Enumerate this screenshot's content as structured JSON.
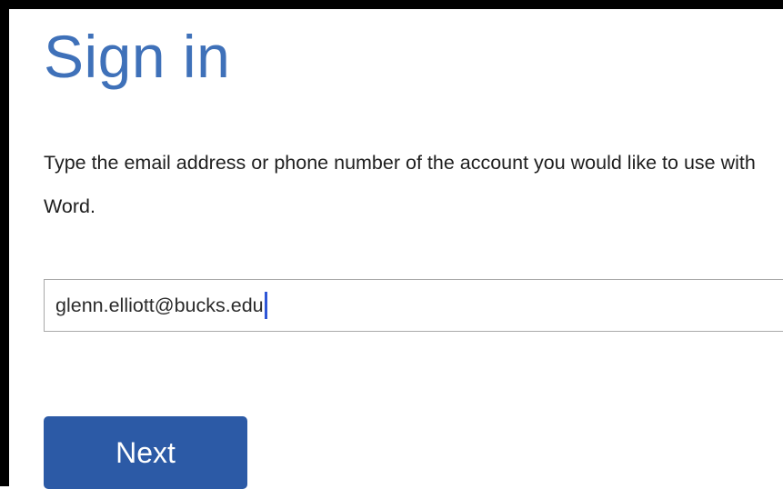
{
  "signin": {
    "title": "Sign in",
    "description": "Type the email address or phone number of the account you would like to use with Word.",
    "email_value": "glenn.elliott@bucks.edu",
    "next_label": "Next"
  },
  "colors": {
    "title": "#3f71b9",
    "button": "#2c5aa6",
    "caret": "#2e56d6",
    "frame": "#000000"
  }
}
